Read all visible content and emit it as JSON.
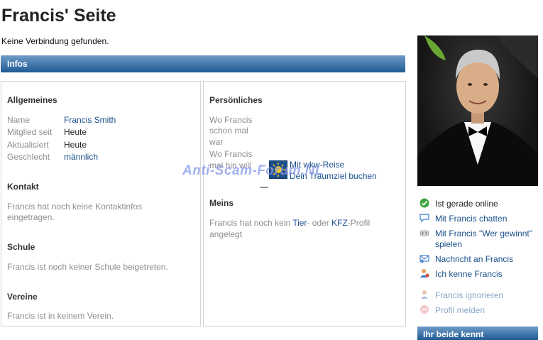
{
  "header": {
    "title": "Francis' Seite",
    "status": "Keine Verbindung gefunden."
  },
  "infos_bar": {
    "label": "Infos"
  },
  "general": {
    "heading": "Allgemeines",
    "rows": [
      {
        "label": "Name",
        "value": "Francis Smith"
      },
      {
        "label": "Mitglied seit",
        "value": "Heute"
      },
      {
        "label": "Aktualisiert",
        "value": "Heute"
      },
      {
        "label": "Geschlecht",
        "value": "männlich"
      }
    ]
  },
  "contact": {
    "heading": "Kontakt",
    "text": "Francis hat noch keine Kontaktinfos eingetragen."
  },
  "school": {
    "heading": "Schule",
    "text": "Francis ist noch keiner Schule beigetreten."
  },
  "clubs": {
    "heading": "Vereine",
    "text": "Francis ist in keinem Verein."
  },
  "personal": {
    "heading": "Persönliches",
    "q1": [
      "Wo Francis",
      "schon mal",
      "war"
    ],
    "q2": [
      "Wo Francis",
      "mal hin will"
    ],
    "ad_line1": "Mit wkw-Reise",
    "ad_line2": "Dein Traumziel buchen"
  },
  "mine": {
    "heading": "Meins",
    "text_prefix": "Francis hat noch kein ",
    "link_tier": "Tier",
    "text_mid": "- oder ",
    "link_kfz": "KFZ",
    "text_suffix": "-Profil",
    "text_line2": "angelegt"
  },
  "watermark": "Anti-Scam-Forum.NL",
  "actions": {
    "online": "Ist gerade online",
    "chat": "Mit Francis chatten",
    "game_line1": "Mit Francis \"Wer gewinnt\"",
    "game_line2": "spielen",
    "message": "Nachricht an Francis",
    "know": "Ich kenne Francis",
    "ignore": "Francis ignorieren",
    "report": "Profil melden"
  },
  "both_know_bar": {
    "label": "Ihr beide kennt"
  },
  "colors": {
    "bar_top": "#6f9bc6",
    "bar_bottom": "#1f5a94",
    "link": "#1a4f8a",
    "online": "#3fa43f"
  },
  "icons": [
    "check-circle-icon",
    "chat-bubble-icon",
    "game-icon",
    "message-icon",
    "contact-icon",
    "ignore-icon",
    "report-icon"
  ]
}
